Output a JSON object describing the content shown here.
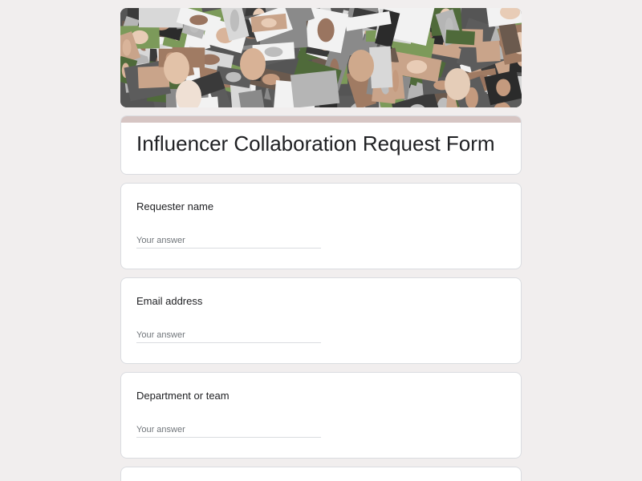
{
  "form": {
    "title": "Influencer Collaboration Request Form",
    "accent_color": "#d6c5c3",
    "background_color": "#f1eeee"
  },
  "banner": {
    "description_icon": "people-collage-image"
  },
  "questions": [
    {
      "label": "Requester name",
      "placeholder": "Your answer",
      "value": ""
    },
    {
      "label": "Email address",
      "placeholder": "Your answer",
      "value": ""
    },
    {
      "label": "Department or team",
      "placeholder": "Your answer",
      "value": ""
    }
  ]
}
